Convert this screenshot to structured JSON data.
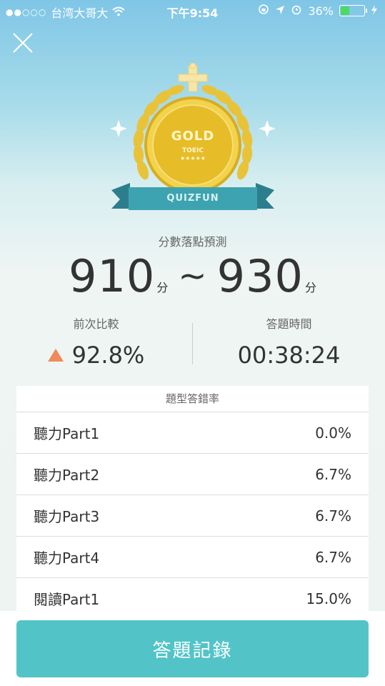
{
  "status_bar": {
    "carrier": "台湾大哥大",
    "time": "下午9:54",
    "battery": "36%"
  },
  "badge": {
    "main": "GOLD",
    "sub": "TOEIC",
    "stars": "★★★★★",
    "ribbon": "QUIZFUN"
  },
  "prediction": {
    "label": "分數落點預測",
    "low": "910",
    "high": "930",
    "unit": "分",
    "separator": "~"
  },
  "stats": {
    "compare_label": "前次比較",
    "compare_value": "92.8%",
    "time_label": "答題時間",
    "time_value": "00:38:24"
  },
  "table": {
    "title": "題型答錯率",
    "rows": [
      {
        "name": "聽力Part1",
        "value": "0.0%"
      },
      {
        "name": "聽力Part2",
        "value": "6.7%"
      },
      {
        "name": "聽力Part3",
        "value": "6.7%"
      },
      {
        "name": "聽力Part4",
        "value": "6.7%"
      },
      {
        "name": "閱讀Part1",
        "value": "15.0%"
      }
    ]
  },
  "footer": {
    "button_label": "答題記錄"
  },
  "colors": {
    "accent": "#52c4c8",
    "up_arrow": "#f08a5d",
    "gold": "#e8c33a"
  }
}
